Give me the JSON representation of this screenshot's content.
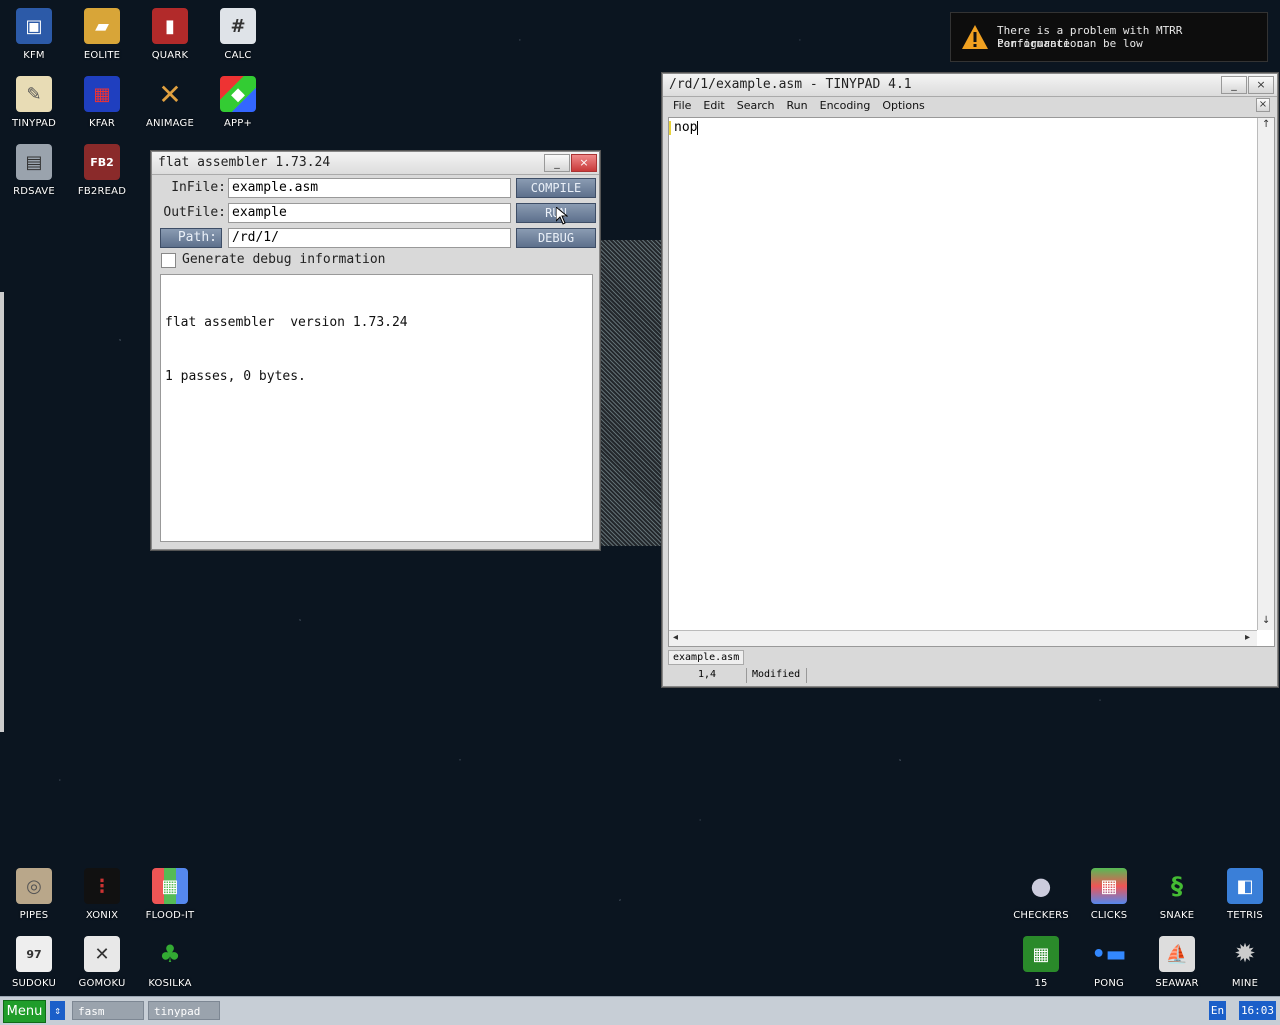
{
  "desktop_icons": {
    "kfm": "KFM",
    "eolite": "EOLITE",
    "quark": "QUARK",
    "calc": "CALC",
    "tinypad": "TINYPAD",
    "kfar": "KFAR",
    "animage": "ANIMAGE",
    "appplus": "APP+",
    "rdsave": "RDSAVE",
    "fb2read": "FB2READ",
    "pipes": "PIPES",
    "xonix": "XONIX",
    "floodit": "FLOOD-IT",
    "sudoku": "SUDOKU",
    "gomoku": "GOMOKU",
    "kosilka": "KOSILKA",
    "checkers": "CHECKERS",
    "clicks": "CLICKS",
    "snake": "SNAKE",
    "tetris": "TETRIS",
    "fifteen": "15",
    "pong": "PONG",
    "seawar": "SEAWAR",
    "mine": "MINE"
  },
  "notification": {
    "line1": "There is a problem with MTRR configuration.",
    "line2": "Performance can be low",
    "icon": "warning-icon"
  },
  "fasm": {
    "title": "flat assembler 1.73.24",
    "infile_label": "InFile:",
    "infile_value": "example.asm",
    "outfile_label": "OutFile:",
    "outfile_value": "example",
    "path_label": "Path:",
    "path_value": "/rd/1/",
    "compile_label": "COMPILE",
    "run_label": "RUN",
    "debug_label": "DEBUG",
    "debug_info_label": "Generate debug information",
    "log_line1": "flat assembler  version 1.73.24",
    "log_line2": "1 passes, 0 bytes."
  },
  "tinypad": {
    "title": "/rd/1/example.asm - TINYPAD 4.1",
    "menu": [
      "File",
      "Edit",
      "Search",
      "Run",
      "Encoding",
      "Options"
    ],
    "content": "nop",
    "tab": "example.asm",
    "position": "1,4",
    "status": "Modified"
  },
  "taskbar": {
    "menu": "Menu",
    "tasks": [
      "fasm",
      "tinypad"
    ],
    "lang": "En",
    "clock": "16:03"
  },
  "colors": {
    "desktop": "#0b1520",
    "taskbar": "#c7ced6",
    "menu_button": "#1f9d2a",
    "accent_button": "#5d708c"
  }
}
